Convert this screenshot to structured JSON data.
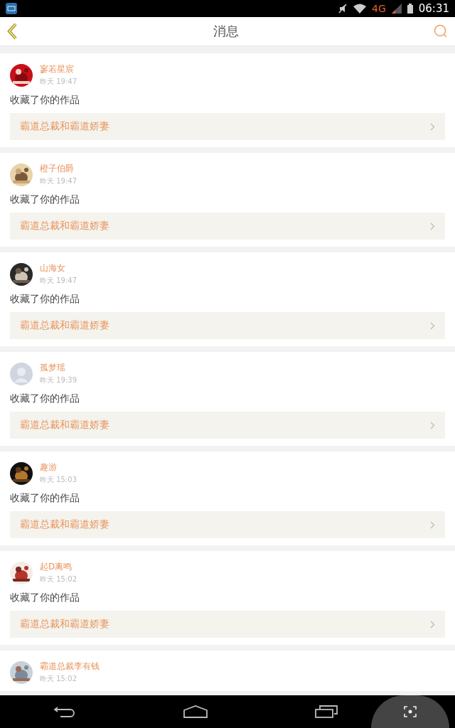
{
  "status_bar": {
    "network": "4G",
    "time": "06:31"
  },
  "header": {
    "title": "消息"
  },
  "messages": [
    {
      "kind": "picture",
      "name": "寥若星宸",
      "time": "昨天 19:47",
      "text": "收藏了你的作品",
      "work": "霸道总裁和霸道娇妻"
    },
    {
      "kind": "picture",
      "name": "橙子伯爵",
      "time": "昨天 19:47",
      "text": "收藏了你的作品",
      "work": "霸道总裁和霸道娇妻"
    },
    {
      "kind": "picture",
      "name": "山海女",
      "time": "昨天 19:47",
      "text": "收藏了你的作品",
      "work": "霸道总裁和霸道娇妻"
    },
    {
      "kind": "default",
      "name": "孤梦瑶",
      "time": "昨天 19:39",
      "text": "收藏了你的作品",
      "work": "霸道总裁和霸道娇妻"
    },
    {
      "kind": "picture",
      "name": "趣游",
      "time": "昨天 15:03",
      "text": "收藏了你的作品",
      "work": "霸道总裁和霸道娇妻"
    },
    {
      "kind": "picture",
      "name": "起D离鸣",
      "time": "昨天 15:02",
      "text": "收藏了你的作品",
      "work": "霸道总裁和霸道娇妻"
    },
    {
      "kind": "picture",
      "name": "霸道总裁李有钱",
      "time": "昨天 15:02"
    }
  ]
}
